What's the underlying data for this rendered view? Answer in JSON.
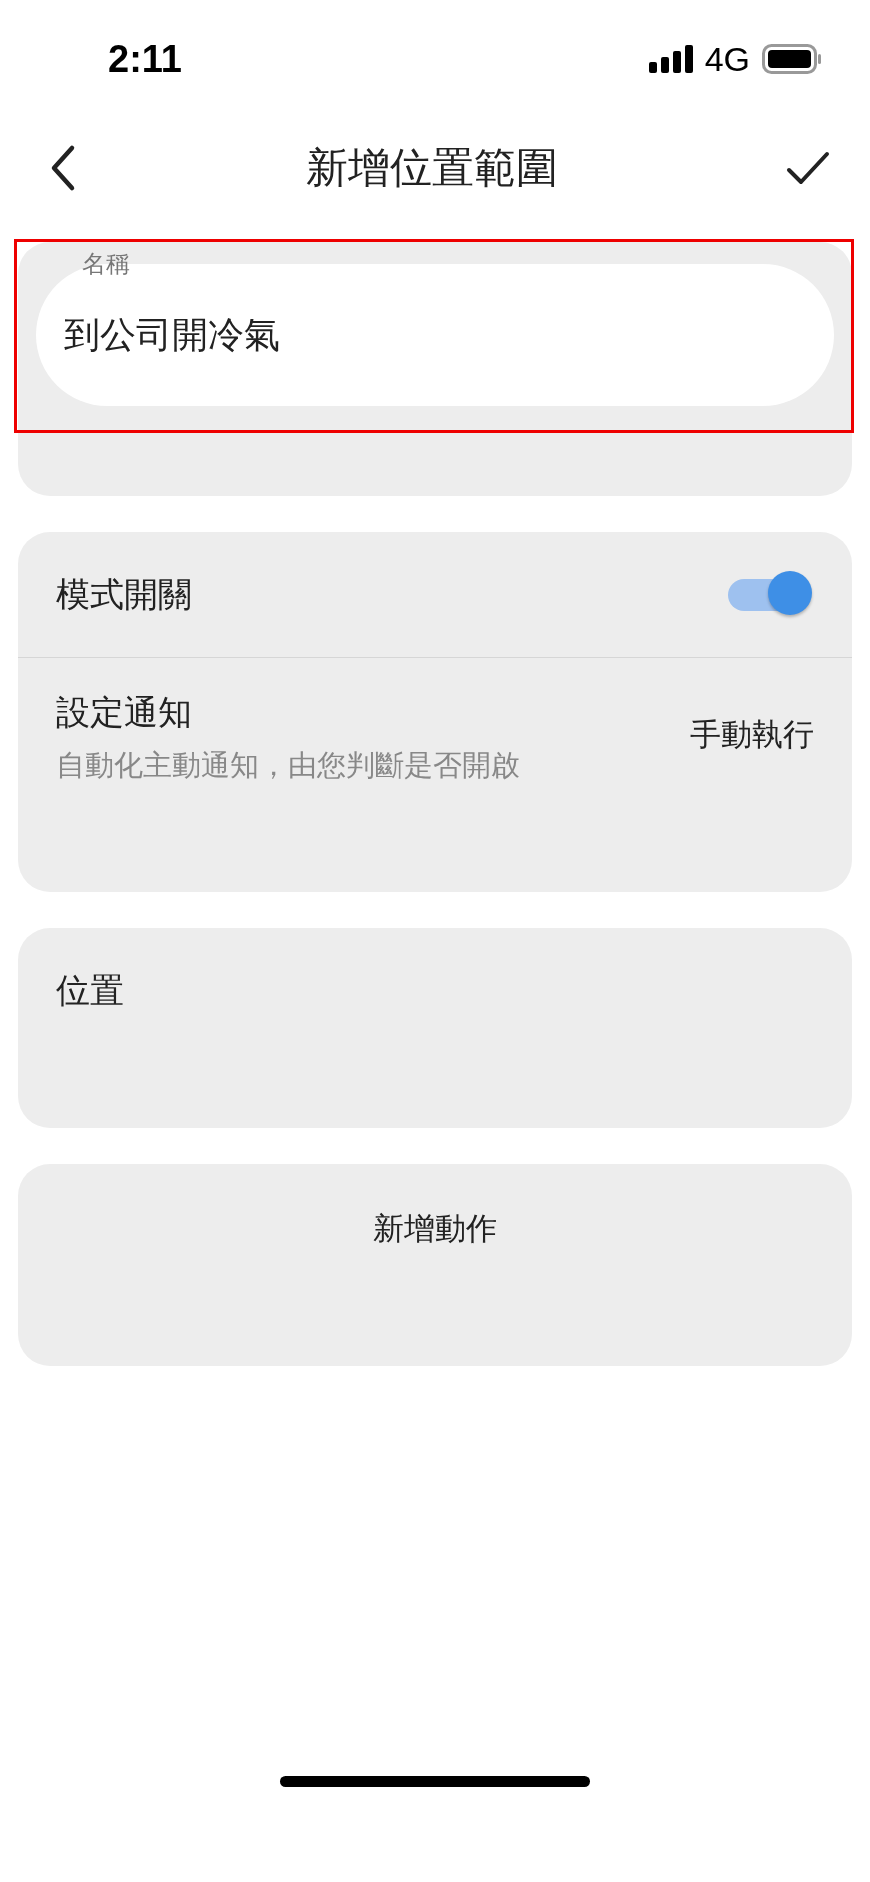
{
  "status_bar": {
    "time": "2:11",
    "network": "4G"
  },
  "header": {
    "title": "新增位置範圍"
  },
  "name_field": {
    "label": "名稱",
    "value": "到公司開冷氣",
    "highlighted": true
  },
  "settings": [
    {
      "kind": "toggle",
      "label": "模式開關",
      "on": true
    },
    {
      "kind": "value",
      "label": "設定通知",
      "description": "自動化主動通知，由您判斷是否開啟",
      "value": "手動執行"
    }
  ],
  "location": {
    "label": "位置"
  },
  "add_action": {
    "label": "新增動作"
  }
}
